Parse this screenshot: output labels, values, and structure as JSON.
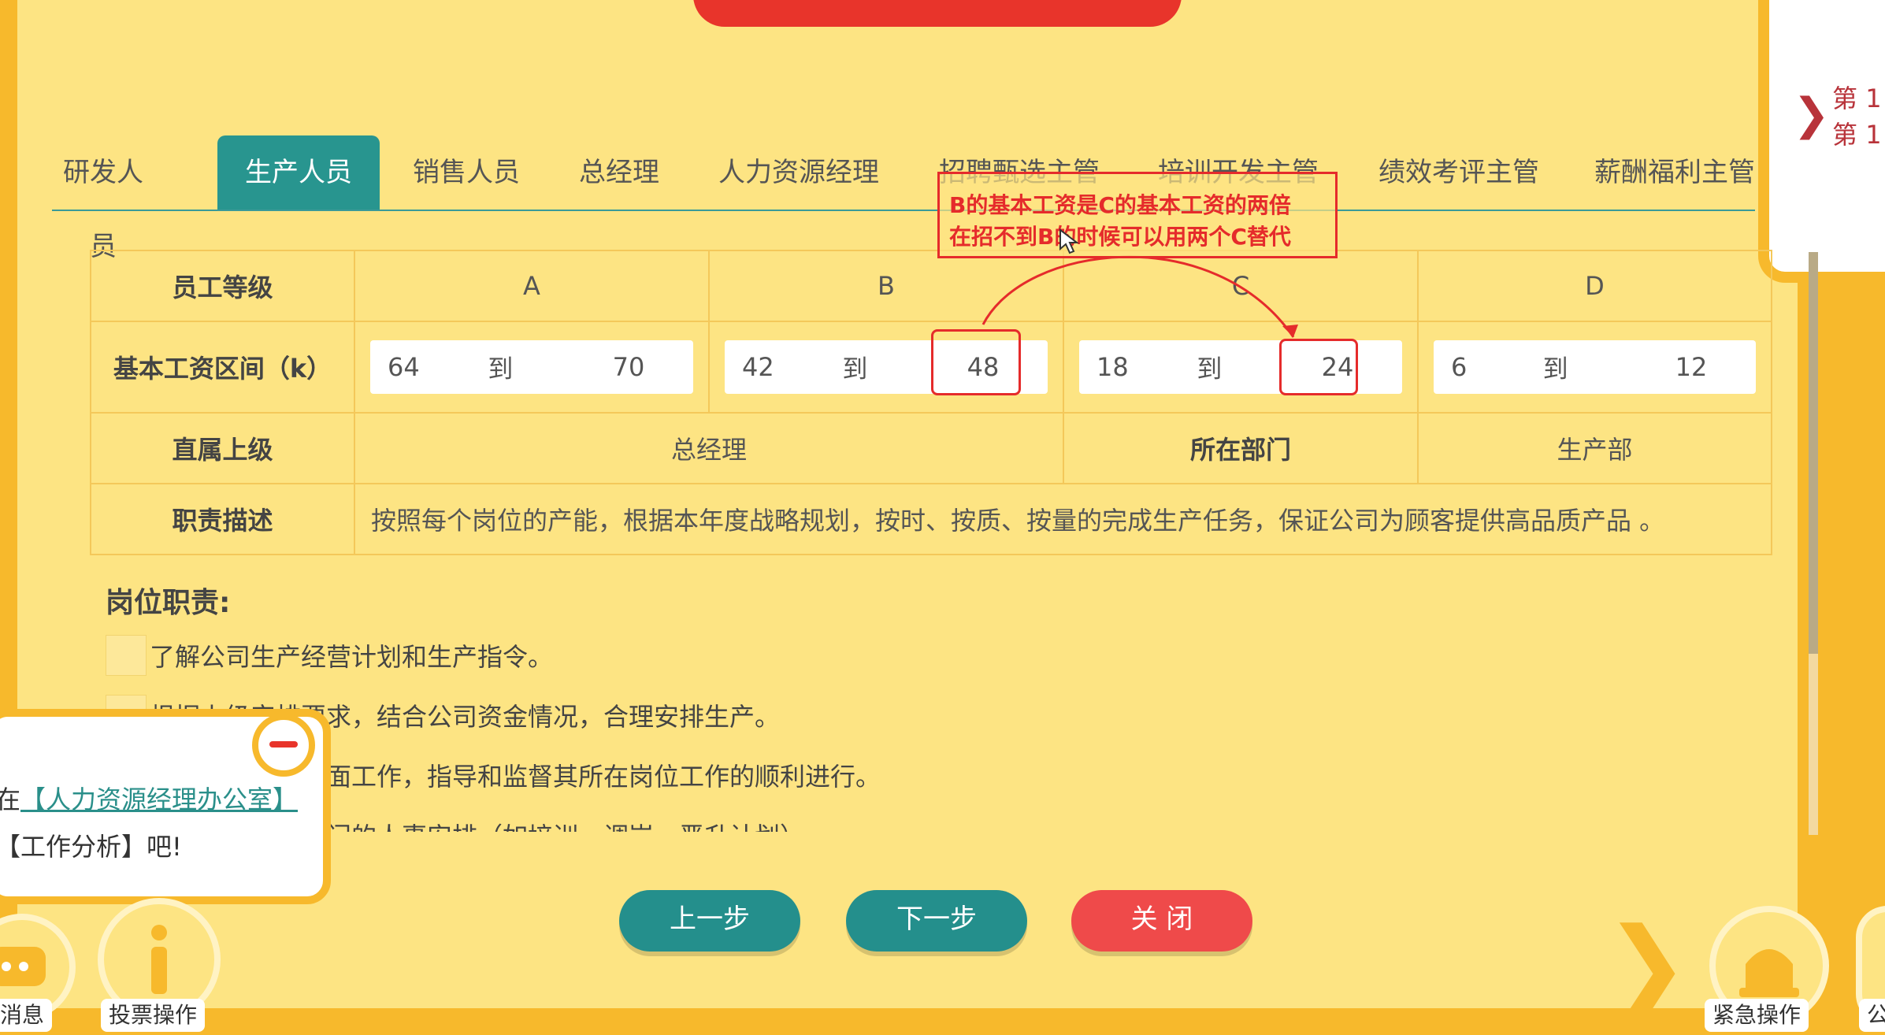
{
  "right_panel": {
    "lines": [
      "第",
      "第"
    ],
    "nums": [
      "1",
      "1"
    ]
  },
  "tabs": [
    {
      "label": "研发人员",
      "active": false
    },
    {
      "label": "生产人员",
      "active": true
    },
    {
      "label": "销售人员",
      "active": false
    },
    {
      "label": "总经理",
      "active": false
    },
    {
      "label": "人力资源经理",
      "active": false
    },
    {
      "label": "招聘甄选主管",
      "active": false
    },
    {
      "label": "培训开发主管",
      "active": false
    },
    {
      "label": "绩效考评主管",
      "active": false
    },
    {
      "label": "薪酬福利主管",
      "active": false
    }
  ],
  "table": {
    "level_label": "员工等级",
    "levels": [
      "A",
      "B",
      "C",
      "D"
    ],
    "salary_label": "基本工资区间（k）",
    "to_label": "到",
    "salaries": [
      {
        "from": "64",
        "to": "70"
      },
      {
        "from": "42",
        "to": "48"
      },
      {
        "from": "18",
        "to": "24"
      },
      {
        "from": "6",
        "to": "12"
      }
    ],
    "superior_label": "直属上级",
    "superior_value": "总经理",
    "dept_label": "所在部门",
    "dept_value": "生产部",
    "desc_label": "职责描述",
    "desc_value": "按照每个岗位的产能，根据本年度战略规划，按时、按质、按量的完成生产任务，保证公司为顾客提供高品质产品 。"
  },
  "duties": {
    "title": "岗位职责:",
    "items": [
      "了解公司生产经营计划和生产指令。",
      "根据上级安排要求，结合公司资金情况，合理安排生产。",
      "负责本部门的全面工作，指导和监督其所在岗位工作的顺利进行。",
      "在部门负责本部门的人事安排（如培训、调岗、晋升计划）"
    ]
  },
  "annotation": {
    "line1": "B的基本工资是C的基本工资的两倍",
    "line2": "在招不到B的时候可以用两个C替代"
  },
  "popup": {
    "prefix": "在",
    "link": "【人力资源经理办公室】",
    "line2": "【工作分析】吧!"
  },
  "buttons": {
    "prev": "上一步",
    "next": "下一步",
    "close": "关 闭"
  },
  "bottom": {
    "messages": "消息",
    "vote": "投票操作",
    "emergency": "紧急操作",
    "announce": "公"
  },
  "colors": {
    "accent": "#28958f",
    "danger": "#ef4a4a",
    "background": "#fde483",
    "frame": "#f7b92c"
  }
}
